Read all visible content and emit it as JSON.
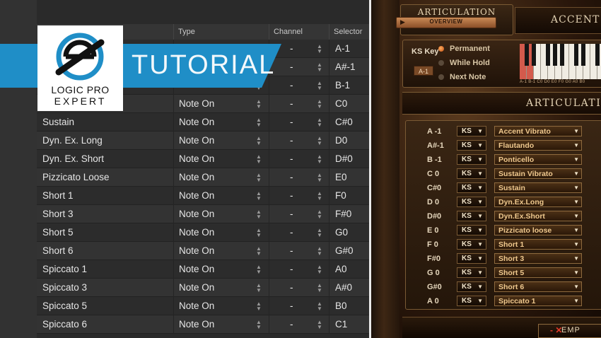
{
  "table": {
    "columns": [
      "",
      "Type",
      "Channel",
      "Selector"
    ],
    "rows": [
      {
        "name": "",
        "type": "",
        "channel": "-",
        "selector": "A-1"
      },
      {
        "name": "",
        "type": "",
        "channel": "-",
        "selector": "A#-1"
      },
      {
        "name": "",
        "type": "",
        "channel": "-",
        "selector": "B-1"
      },
      {
        "name": "",
        "type": "Note On",
        "channel": "-",
        "selector": "C0"
      },
      {
        "name": "Sustain",
        "type": "Note On",
        "channel": "-",
        "selector": "C#0"
      },
      {
        "name": "Dyn. Ex. Long",
        "type": "Note On",
        "channel": "-",
        "selector": "D0"
      },
      {
        "name": "Dyn. Ex. Short",
        "type": "Note On",
        "channel": "-",
        "selector": "D#0"
      },
      {
        "name": "Pizzicato Loose",
        "type": "Note On",
        "channel": "-",
        "selector": "E0"
      },
      {
        "name": "Short 1",
        "type": "Note On",
        "channel": "-",
        "selector": "F0"
      },
      {
        "name": "Short 3",
        "type": "Note On",
        "channel": "-",
        "selector": "F#0"
      },
      {
        "name": "Short 5",
        "type": "Note On",
        "channel": "-",
        "selector": "G0"
      },
      {
        "name": "Short 6",
        "type": "Note On",
        "channel": "-",
        "selector": "G#0"
      },
      {
        "name": "Spiccato 1",
        "type": "Note On",
        "channel": "-",
        "selector": "A0"
      },
      {
        "name": "Spiccato 3",
        "type": "Note On",
        "channel": "-",
        "selector": "A#0"
      },
      {
        "name": "Spiccato 5",
        "type": "Note On",
        "channel": "-",
        "selector": "B0"
      },
      {
        "name": "Spiccato 6",
        "type": "Note On",
        "channel": "-",
        "selector": "C1"
      }
    ]
  },
  "banner": {
    "text": "TUTORIAL",
    "logo_line1": "LOGIC PRO",
    "logo_line2": "EXPERT",
    "color": "#1f8ec7"
  },
  "plugin": {
    "tab_title": "ARTICULATION",
    "overview_label": "OVERVIEW",
    "accent_title": "ACCENT V",
    "ks_key_label": "KS Key",
    "ks_key_value": "A-1",
    "options": [
      "Permanent",
      "While Hold",
      "Next Note"
    ],
    "keyboard_labels": "A-1 B-1 C0 D0 E0 F0 G0 A0 B0",
    "section_title": "ARTICULATIO",
    "mappings": [
      {
        "note": "A -1",
        "mode": "KS",
        "articulation": "Accent Vibrato"
      },
      {
        "note": "A#-1",
        "mode": "KS",
        "articulation": "Flautando"
      },
      {
        "note": "B -1",
        "mode": "KS",
        "articulation": "Ponticello"
      },
      {
        "note": "C  0",
        "mode": "KS",
        "articulation": "Sustain Vibrato"
      },
      {
        "note": "C#0",
        "mode": "KS",
        "articulation": "Sustain"
      },
      {
        "note": "D  0",
        "mode": "KS",
        "articulation": "Dyn.Ex.Long"
      },
      {
        "note": "D#0",
        "mode": "KS",
        "articulation": "Dyn.Ex.Short"
      },
      {
        "note": "E  0",
        "mode": "KS",
        "articulation": "Pizzicato loose"
      },
      {
        "note": "F  0",
        "mode": "KS",
        "articulation": "Short 1"
      },
      {
        "note": "F#0",
        "mode": "KS",
        "articulation": "Short 3"
      },
      {
        "note": "G  0",
        "mode": "KS",
        "articulation": "Short 5"
      },
      {
        "note": "G#0",
        "mode": "KS",
        "articulation": "Short 6"
      },
      {
        "note": "A  0",
        "mode": "KS",
        "articulation": "Spiccato 1"
      }
    ],
    "empty_label": "EMP"
  }
}
